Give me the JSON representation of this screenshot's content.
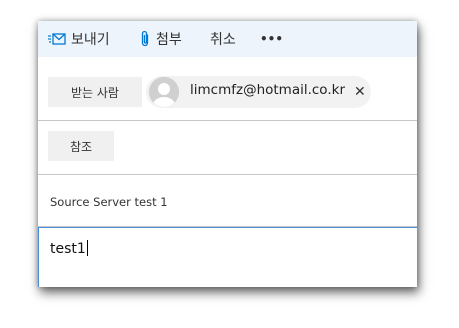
{
  "toolbar": {
    "send_label": "보내기",
    "attach_label": "첨부",
    "cancel_label": "취소",
    "more_label": "•••",
    "send_icon": "send-envelope-icon",
    "attach_icon": "paperclip-icon",
    "accent_color": "#0078d4"
  },
  "to": {
    "label": "받는 사람",
    "recipients": [
      {
        "email": "limcmfz@hotmail.co.kr",
        "remove_label": "✕"
      }
    ]
  },
  "cc": {
    "label": "참조"
  },
  "subject": {
    "value": "Source Server test 1"
  },
  "body": {
    "text": "test1"
  }
}
